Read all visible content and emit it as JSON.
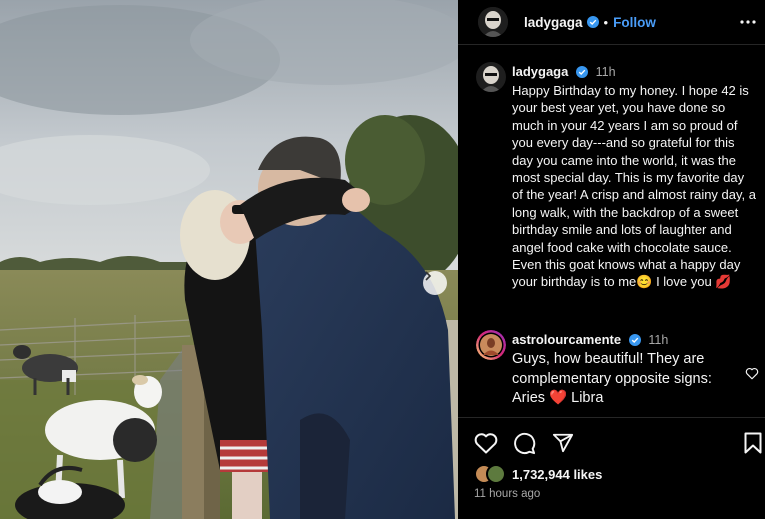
{
  "post": {
    "author": "ladygaga",
    "follow_label": "Follow",
    "separator": "•"
  },
  "comments": [
    {
      "username": "ladygaga",
      "time": "11h",
      "text": "Happy Birthday to my honey. I hope 42 is your best year yet, you have done so much in your 42 years I am so proud of you every day---and so grateful for this day you came into the world, it was the most special day. This is my favorite day of the year! A crisp and almost rainy day, a long walk, with the backdrop of a sweet birthday smile and lots of laughter and angel food cake with chocolate sauce.  Even this goat knows what a happy day your birthday is to me😊 I love you 💋"
    },
    {
      "username": "astrolourcamente",
      "time": "11h",
      "text": "Guys, how beautiful! They are complementary opposite signs: Aries ❤️ Libra"
    }
  ],
  "footer": {
    "likes": "1,732,944 likes",
    "posted": "11 hours ago"
  },
  "icons": {
    "verified": "verified-badge-icon",
    "more": "more-options-icon",
    "like": "heart-icon",
    "comment": "comment-bubble-icon",
    "share": "share-paper-plane-icon",
    "save": "bookmark-icon",
    "next": "chevron-right-icon"
  },
  "colors": {
    "link": "#4a9df8",
    "verified": "#3897f0",
    "background": "#000000",
    "secondary_text": "#a8a8a8"
  }
}
